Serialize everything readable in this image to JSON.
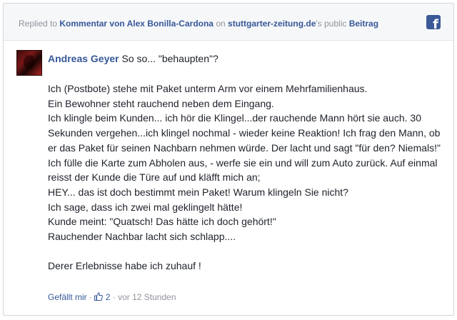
{
  "header": {
    "replied_to": "Replied to",
    "comment_link": "Kommentar von Alex Bonilla-Cardona",
    "on": "on",
    "site_link": "stuttgarter-zeitung.de",
    "public_text": "'s public",
    "post_link": "Beitrag",
    "platform_icon": "facebook-icon"
  },
  "comment": {
    "author": "Andreas Geyer",
    "intro": "So so... \"behaupten\"?",
    "lines": [
      "Ich (Postbote) stehe mit Paket unterm Arm vor einem Mehrfamilienhaus.",
      "Ein Bewohner steht rauchend neben dem Eingang.",
      "Ich klingle beim Kunden... ich hör die Klingel...der rauchende Mann hört sie auch. 30 Sekunden vergehen...ich klingel nochmal - wieder keine Reaktion! Ich frag den Mann, ob er das Paket für seinen Nachbarn nehmen würde. Der lacht und sagt \"für den? Niemals!\"",
      "Ich fülle die Karte zum Abholen aus, - werfe sie ein und will zum Auto zurück. Auf einmal reisst der Kunde die Türe auf und kläfft mich an;",
      "HEY... das ist doch bestimmt mein Paket! Warum klingeln Sie nicht?",
      "Ich sage, dass ich zwei mal geklingelt hätte!",
      "Kunde meint: \"Quatsch! Das hätte ich doch gehört!\"",
      "Rauchender Nachbar lacht sich schlapp....",
      "Derer Erlebnisse habe ich zuhauf !"
    ]
  },
  "actions": {
    "like_label": "Gefällt mir",
    "separator": "·",
    "like_count": "2",
    "timestamp": "vor 12 Stunden"
  },
  "colors": {
    "link": "#365899",
    "muted": "#90949c",
    "facebook": "#3b5998"
  }
}
